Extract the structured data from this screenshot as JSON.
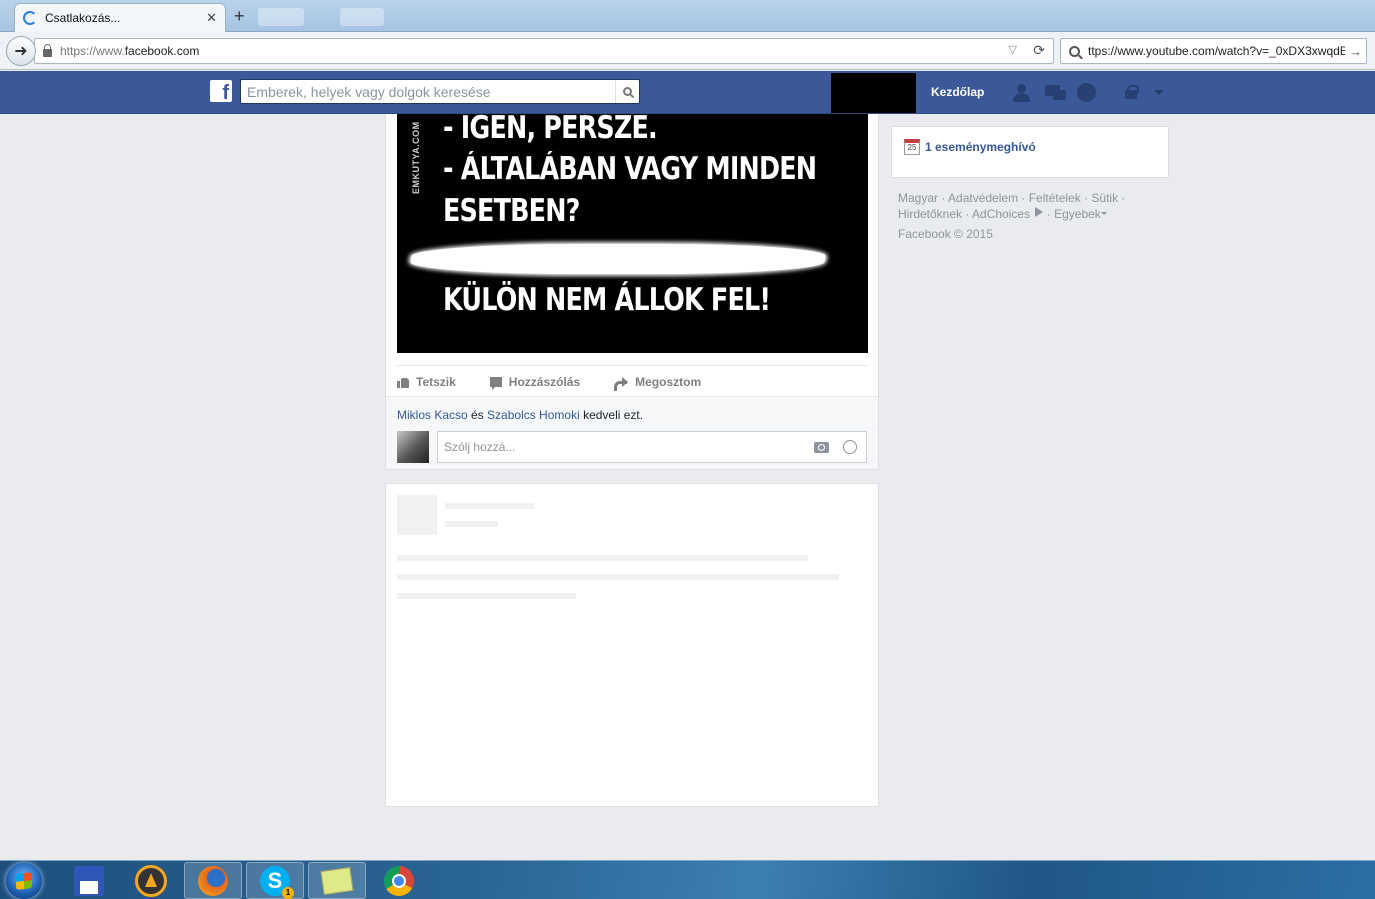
{
  "browser": {
    "tab_title": "Csatlakozás...",
    "tab_close": "✕",
    "new_tab": "+",
    "url_protocol": "https://www.",
    "url_host": "facebook.com",
    "search_text": "ttps://www.youtube.com/watch?v=_0xDX3xwqdE"
  },
  "fb_header": {
    "search_placeholder": "Emberek, helyek vagy dolgok keresése",
    "logo": "f",
    "home_label": "Kezdőlap",
    "brand_color": "#3b5998"
  },
  "post": {
    "image": {
      "watermark": "EMKUTYA.COM",
      "lines": [
        "- IGEN, PERSZE.",
        "- ÁLTALÁBAN VAGY MINDEN",
        "ESETBEN?",
        "KÜLÖN NEM ÁLLOK FEL!"
      ]
    },
    "actions": {
      "like": "Tetszik",
      "comment": "Hozzászólás",
      "share": "Megosztom"
    },
    "likes": {
      "person1": "Miklos Kacso",
      "conj": " és ",
      "person2": "Szabolcs Homoki",
      "suffix": " kedveli ezt."
    },
    "comment_placeholder": "Szólj hozzá..."
  },
  "sidebar": {
    "calendar_day": "25",
    "events_label": "1 eseménymeghívó",
    "footer_line1": "Magyar · Adatvédelem · Feltételek · Sütik ·",
    "footer_line2a": "Hirdetőknek · AdChoices",
    "footer_line2b": " · Egyebek",
    "copyright": "Facebook © 2015"
  },
  "taskbar": {
    "skype_badge": "1",
    "skype_letter": "S"
  }
}
